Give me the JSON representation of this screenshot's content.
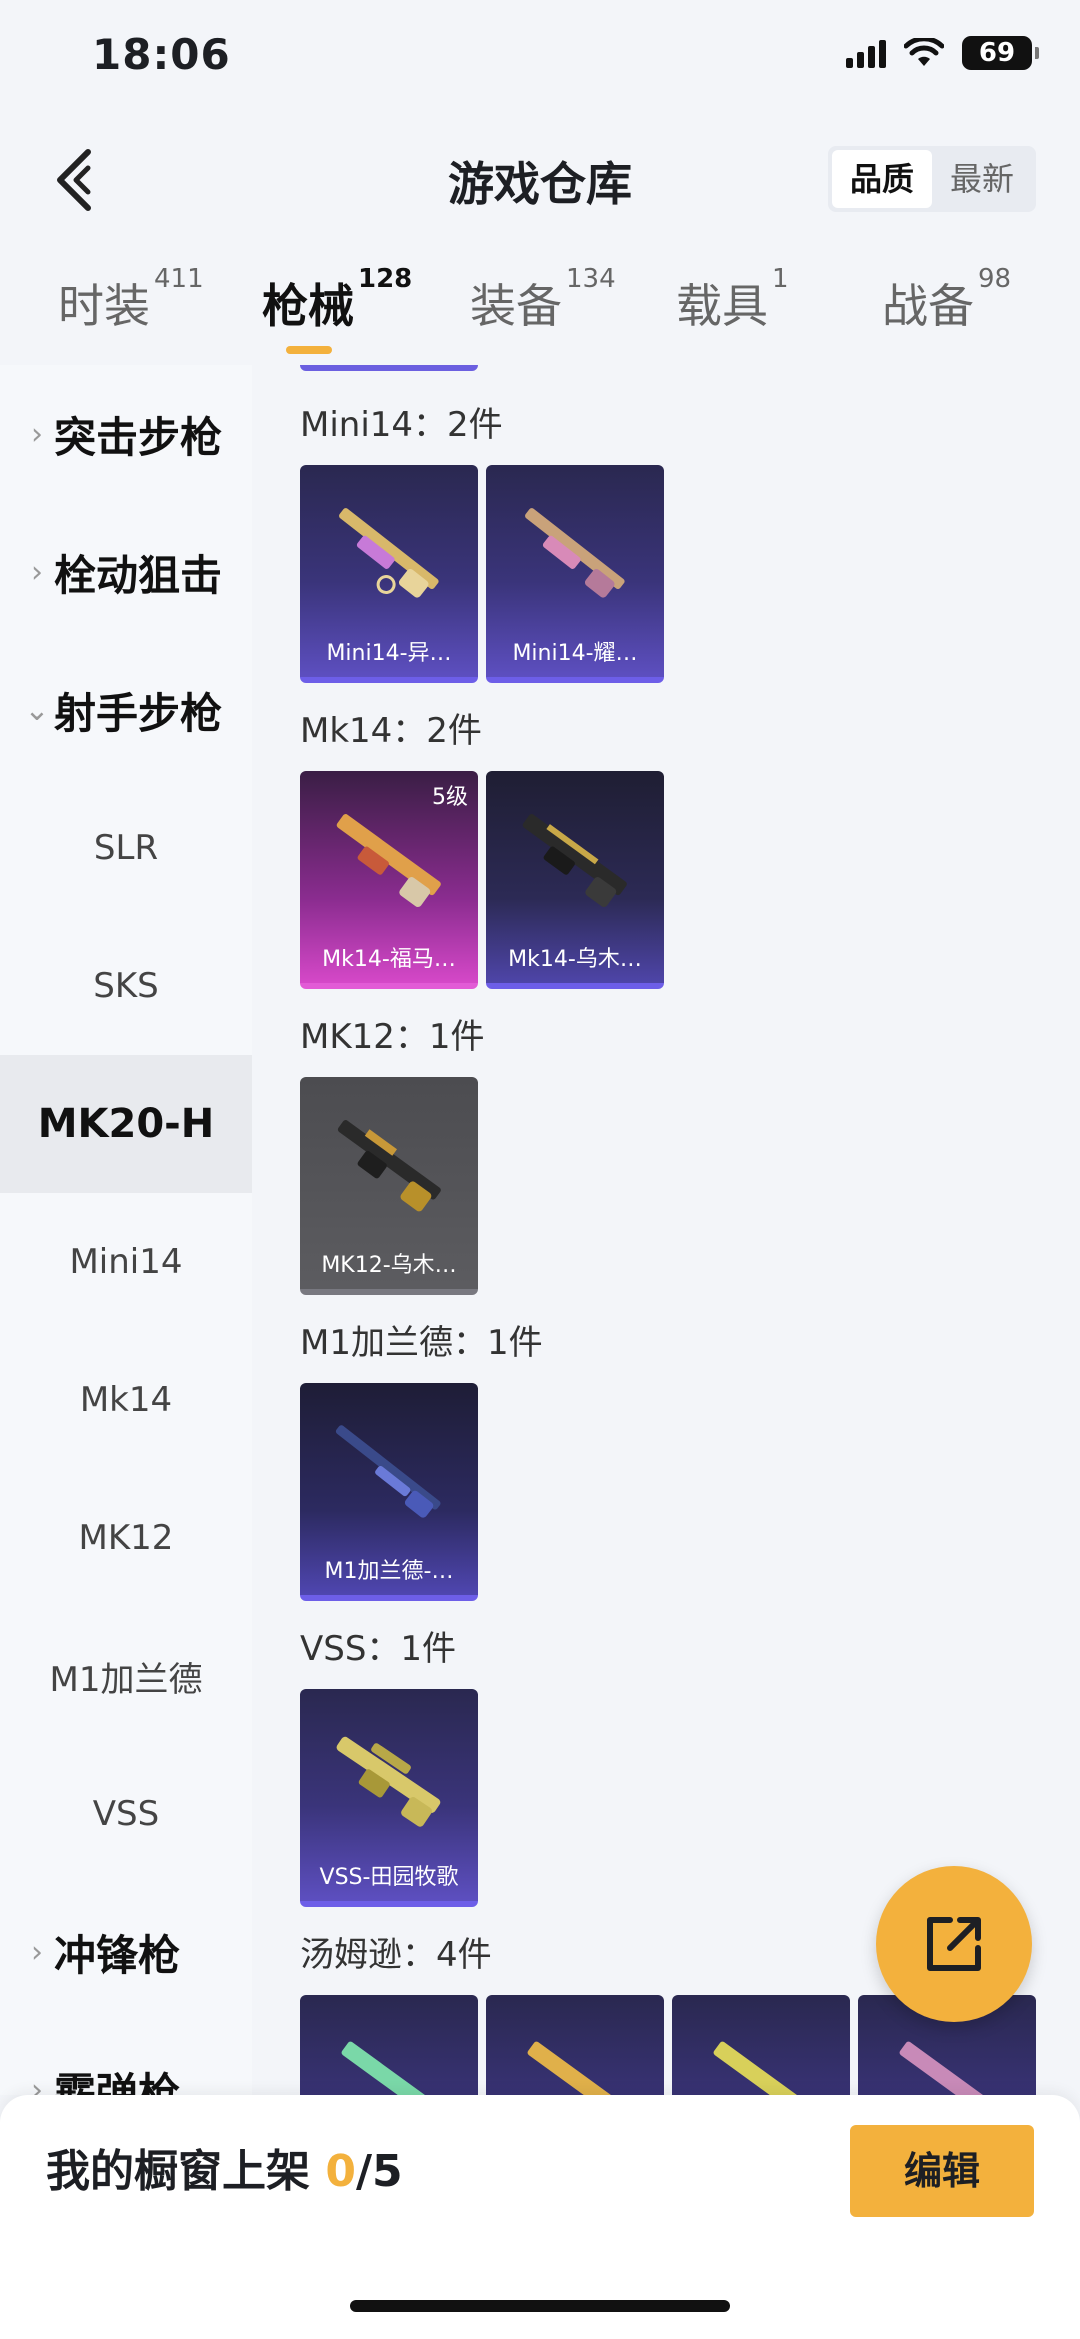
{
  "status": {
    "time": "18:06",
    "battery": "69"
  },
  "header": {
    "title": "游戏仓库",
    "sort_quality": "品质",
    "sort_newest": "最新"
  },
  "tabs": [
    {
      "label": "时装",
      "count": "411"
    },
    {
      "label": "枪械",
      "count": "128"
    },
    {
      "label": "装备",
      "count": "134"
    },
    {
      "label": "载具",
      "count": "1"
    },
    {
      "label": "战备",
      "count": "98"
    }
  ],
  "sidebar": {
    "items": [
      {
        "label": "突击步枪"
      },
      {
        "label": "栓动狙击"
      },
      {
        "label": "射手步枪"
      },
      {
        "label": "SLR"
      },
      {
        "label": "SKS"
      },
      {
        "label": "MK20-H"
      },
      {
        "label": "Mini14"
      },
      {
        "label": "Mk14"
      },
      {
        "label": "MK12"
      },
      {
        "label": "M1加兰德"
      },
      {
        "label": "VSS"
      },
      {
        "label": "冲锋枪"
      },
      {
        "label": "霰弹枪"
      }
    ]
  },
  "groups": [
    {
      "title": "Mini14：2件",
      "cards": [
        {
          "name": "Mini14-异…"
        },
        {
          "name": "Mini14-耀…"
        }
      ]
    },
    {
      "title": "Mk14：2件",
      "cards": [
        {
          "name": "Mk14-福马…",
          "level": "5级"
        },
        {
          "name": "Mk14-乌木…"
        }
      ]
    },
    {
      "title": "MK12：1件",
      "cards": [
        {
          "name": "MK12-乌木…"
        }
      ]
    },
    {
      "title": "M1加兰德：1件",
      "cards": [
        {
          "name": "M1加兰德-…"
        }
      ]
    },
    {
      "title": "VSS：1件",
      "cards": [
        {
          "name": "VSS-田园牧歌"
        }
      ]
    },
    {
      "title": "汤姆逊：4件",
      "cards": []
    }
  ],
  "bottom": {
    "shelf_label": "我的橱窗上架",
    "shelf_count": "0",
    "shelf_total": "/5",
    "edit_label": "编辑"
  },
  "colors": {
    "accent": "#f3b13d",
    "purple_rarity": "#6d5ee8",
    "pink_rarity": "#e25bd6"
  }
}
